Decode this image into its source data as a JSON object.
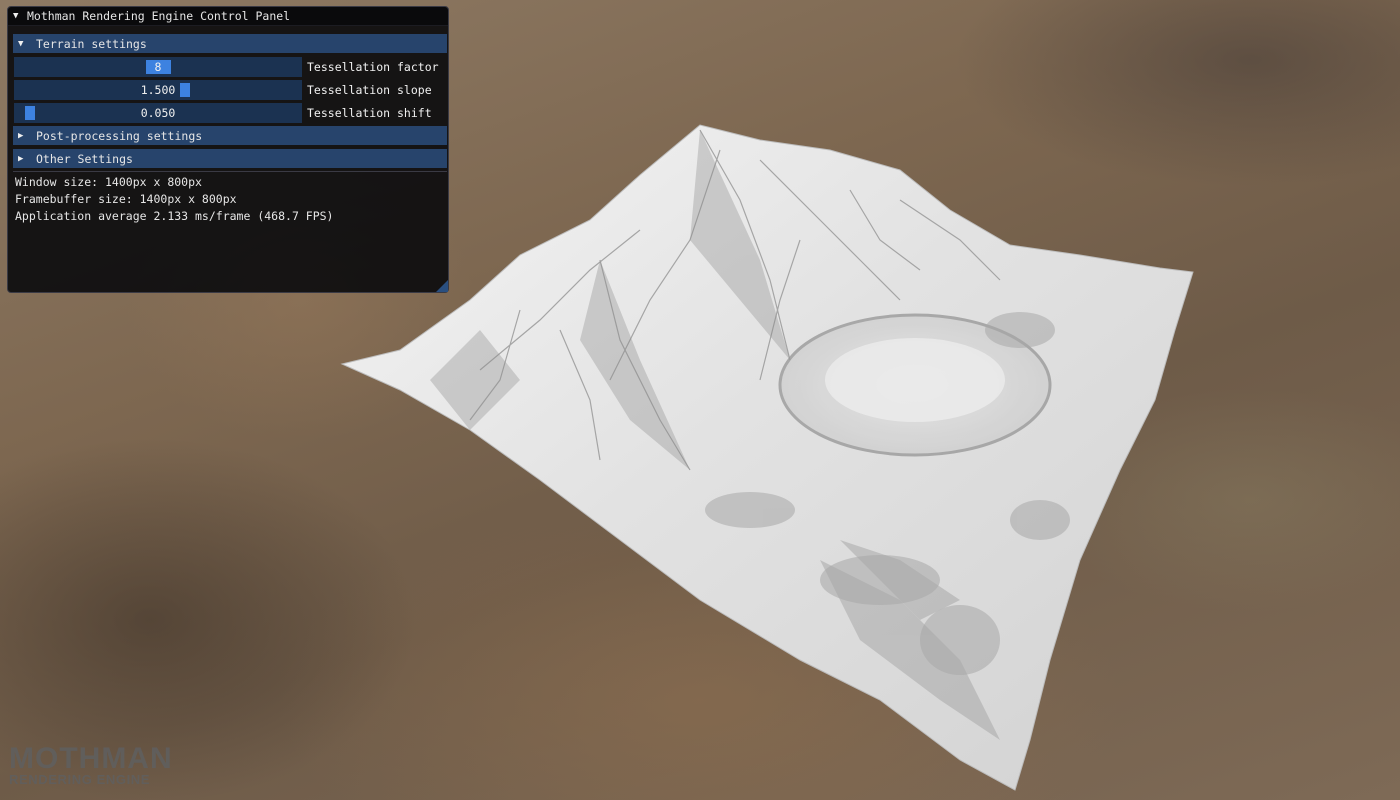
{
  "panel": {
    "title": "Mothman Rendering Engine Control Panel",
    "sections": {
      "terrain": "Terrain settings",
      "post_processing": "Post-processing settings",
      "other": "Other Settings"
    },
    "sliders": {
      "tessellation_factor": {
        "value": "8",
        "label": "Tessellation factor",
        "level": 0.5
      },
      "tessellation_slope": {
        "value": "1.500",
        "label": "Tessellation slope",
        "level": 0.6
      },
      "tessellation_shift": {
        "value": "0.050",
        "label": "Tessellation shift",
        "level": 0.03
      }
    },
    "info": {
      "window_size": "Window size: 1400px x 800px",
      "framebuffer_size": "Framebuffer size: 1400px x 800px",
      "frame_time": "Application average 2.133 ms/frame (468.7 FPS)"
    }
  },
  "logo": {
    "main": "MOTHMAN",
    "sub": "RENDERING ENGINE"
  },
  "colors": {
    "panel_bg": "#0c0c0e",
    "header_bg": "#27446c",
    "slider_track": "#1b3251",
    "slider_grab": "#3d82e0",
    "terrain": "#e8e8e8"
  },
  "icons": {
    "expanded": "triangle-down",
    "collapsed": "triangle-right"
  }
}
